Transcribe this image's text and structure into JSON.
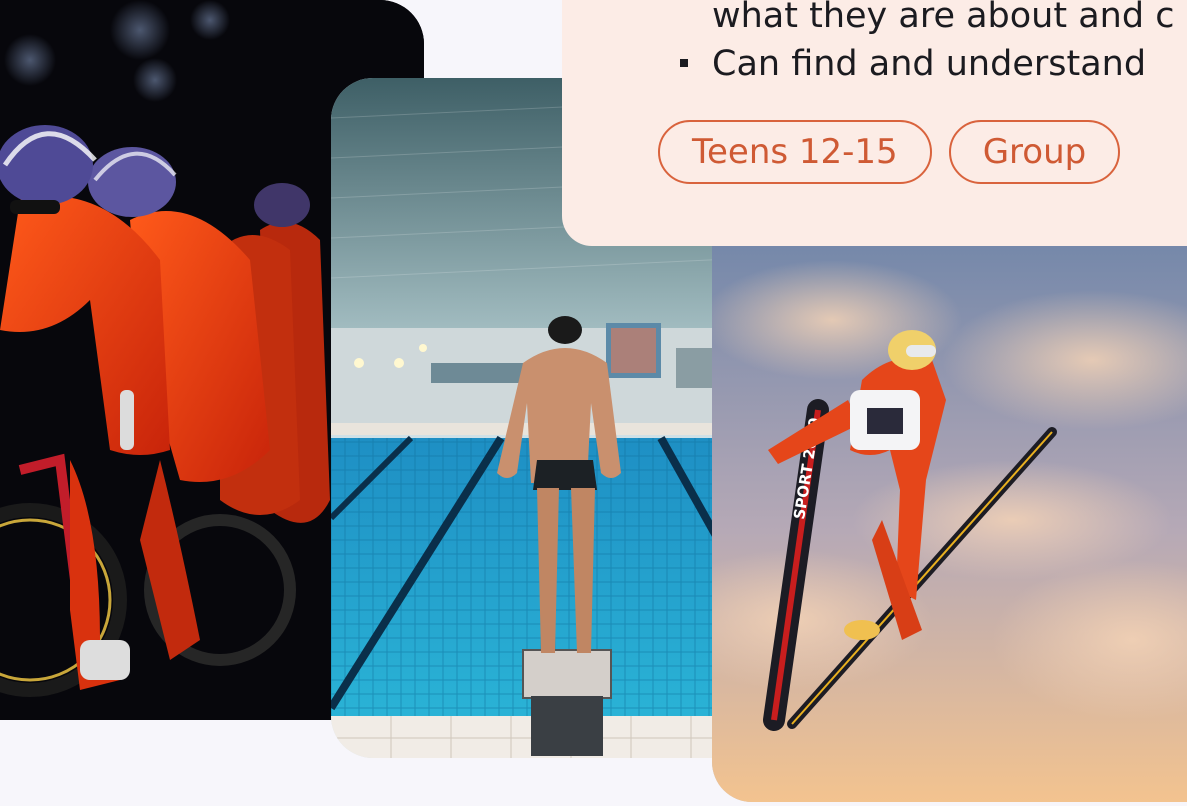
{
  "info": {
    "lines": [
      "what they are about and c",
      "Can find and understand"
    ],
    "tags": [
      "Teens 12-15",
      "Group"
    ]
  },
  "photos": {
    "swim_block_sign": "",
    "ski_banner": "SPORT 2000"
  },
  "colors": {
    "card_bg": "#fcece6",
    "tag_accent": "#d9633d",
    "text": "#1b1b20"
  }
}
